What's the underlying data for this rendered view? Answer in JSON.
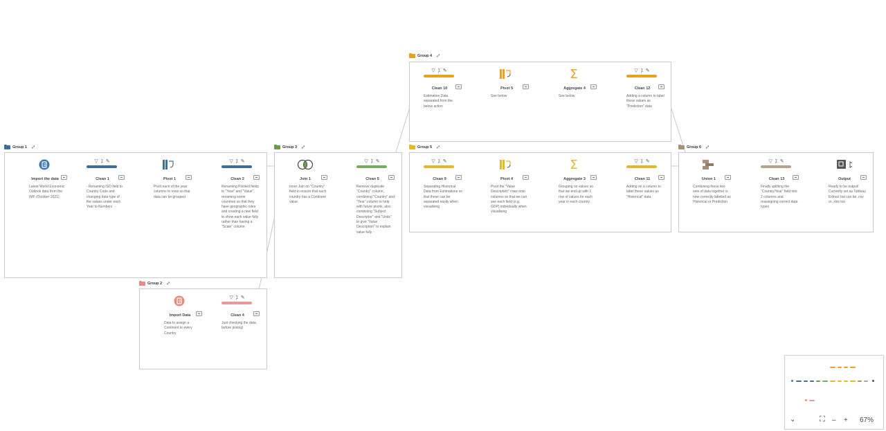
{
  "groups": [
    {
      "label": "Group 1",
      "color": "#3d6f9a"
    },
    {
      "label": "Group 2",
      "color": "#e88a8a"
    },
    {
      "label": "Group 3",
      "color": "#6a9a4d"
    },
    {
      "label": "Group 4",
      "color": "#e8a020"
    },
    {
      "label": "Group 5",
      "color": "#e3b92a"
    },
    {
      "label": "Group 6",
      "color": "#a89078"
    }
  ],
  "steps": {
    "import1": {
      "name": "Import the data",
      "icon": "input-data-icon",
      "color": "#3d78b0",
      "desc": "Latest World Economic Outlook data from the IMF (October 2021)"
    },
    "clean1": {
      "name": "Clean 1",
      "icon": "clean-step-icon",
      "color": "#3d6f9a",
      "desc": "- Renaming ISO field to Country Code and changing data type of the values under each Year to Numbers"
    },
    "pivot1": {
      "name": "Pivot 1",
      "icon": "pivot-step-icon",
      "color": "#3d6f9a",
      "desc": "Pivot each of the year columns to rows so that data can be grouped"
    },
    "clean2": {
      "name": "Clean 2",
      "icon": "clean-step-icon",
      "color": "#3d6f9a",
      "desc": "Renaming Pivoted fields to \"Year\" and \"Value\", renaming some countries so that they have geographic roles and creating a new field to show each value fully rather than having a \"Scale\" column"
    },
    "join1": {
      "name": "Join 1",
      "icon": "join-icon",
      "color": "#6a9a4d",
      "desc": "Inner Join on \"Country\" field to ensure that each country has a Continent value"
    },
    "clean5": {
      "name": "Clean 5",
      "icon": "clean-step-icon",
      "color": "#7aaa5e",
      "desc": "Remove duplicate \"Country\" column, combining \"Country\" and \"Year\" column to help with future pivots, also combining \"Subject Descriptor\" and \"Units\" to give \"Value Description\" to explain value fully"
    },
    "import2": {
      "name": "Import Data",
      "icon": "input-data-icon",
      "color": "#e88a7a",
      "desc": "Data to assign a Continent to every Country"
    },
    "clean4": {
      "name": "Clean 4",
      "icon": "clean-step-icon",
      "color": "#e89a9a",
      "desc": "Just checking the data before joining!"
    },
    "clean10": {
      "name": "Clean 10",
      "icon": "clean-step-icon",
      "color": "#e8a020",
      "desc": "Estimation Data separated from the below action"
    },
    "pivot5": {
      "name": "Pivot 5",
      "icon": "pivot-step-icon",
      "color": "#e8a020",
      "desc": "See below"
    },
    "aggregate4": {
      "name": "Aggregate 4",
      "icon": "aggregate-icon",
      "color": "#e8a020",
      "desc": "See below"
    },
    "clean12": {
      "name": "Clean 12",
      "icon": "clean-step-icon",
      "color": "#e8a020",
      "desc": "Adding a column to label these values as \"Prediction\" data"
    },
    "clean9": {
      "name": "Clean 9",
      "icon": "clean-step-icon",
      "color": "#e3b92a",
      "desc": "Separating Historical Data from Estimations so that these can be separated easily when visualising"
    },
    "pivot4": {
      "name": "Pivot 4",
      "icon": "pivot-step-icon",
      "color": "#e3b92a",
      "desc": "Pivot the \"Value Description\" rows onto columns so that we can see each field (e.g. GDP) individually when visualising"
    },
    "aggregate3": {
      "name": "Aggregate 3",
      "icon": "aggregate-icon",
      "color": "#e3b92a",
      "desc": "Grouping on values so that we end up with 1 row of values for each year in each country"
    },
    "clean11": {
      "name": "Clean 11",
      "icon": "clean-step-icon",
      "color": "#e3b92a",
      "desc": "Adding on a column to label these values as \"Historical\" data"
    },
    "union1": {
      "name": "Union 1",
      "icon": "union-icon",
      "color": "#a89078",
      "desc": "Combining these two sets of data together is now correctly labelled as Historical or Prediction"
    },
    "clean13": {
      "name": "Clean 13",
      "icon": "clean-step-icon",
      "color": "#b5a38f",
      "desc": "Finally splitting the \"Country/Year\" field into 2 columns and reassigning correct data types"
    },
    "output": {
      "name": "Output",
      "icon": "output-icon",
      "color": "#555555",
      "desc": "Ready to be output! Currently set as Tableau Extract but can be .csv or .xlsx too"
    }
  },
  "clean_icons": "▽ ⁒ ✎",
  "zoom": {
    "level": "67%"
  }
}
